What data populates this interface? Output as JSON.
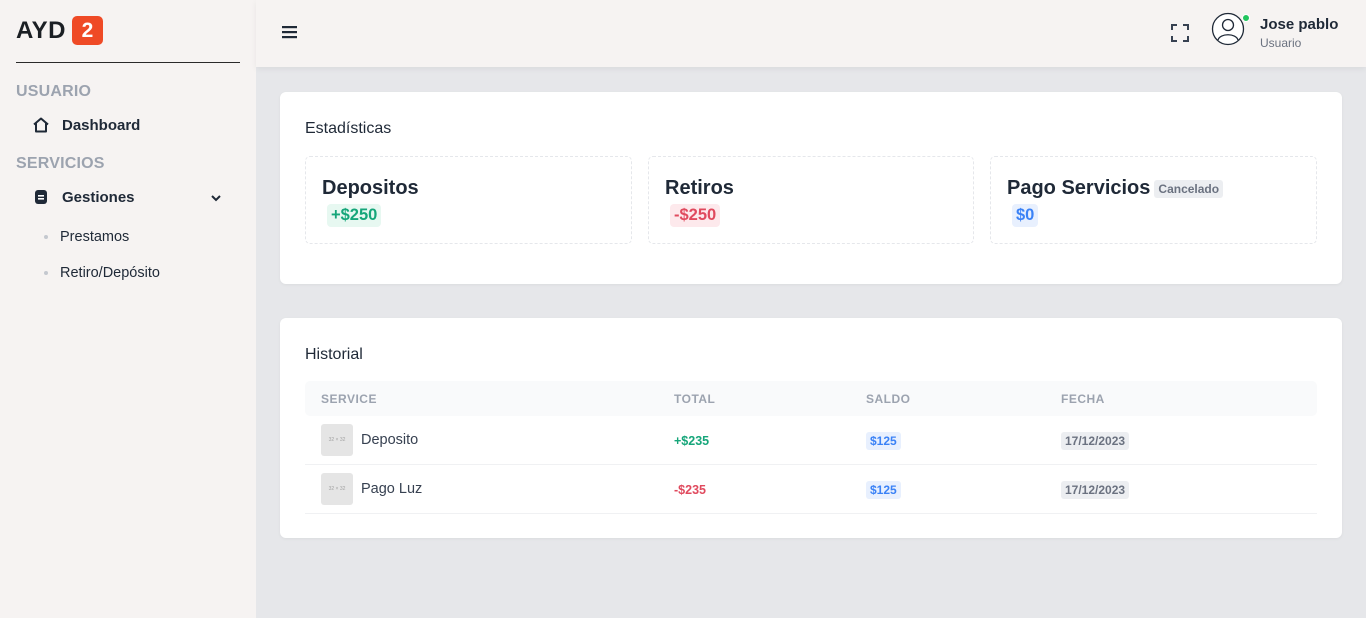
{
  "logo": {
    "text": "AYD",
    "badge": "2"
  },
  "sidebar": {
    "section_usuario": "USUARIO",
    "dashboard": "Dashboard",
    "section_servicios": "SERVICIOS",
    "gestiones": "Gestiones",
    "sub_items": [
      "Prestamos",
      "Retiro/Depósito"
    ]
  },
  "header": {
    "user_name": "Jose pablo",
    "user_role": "Usuario"
  },
  "stats": {
    "title": "Estadísticas",
    "items": [
      {
        "label": "Depositos",
        "amount": "+$250"
      },
      {
        "label": "Retiros",
        "amount": "-$250"
      },
      {
        "label": "Pago Servicios",
        "tag": "Cancelado",
        "amount": "$0"
      }
    ]
  },
  "history": {
    "title": "Historial",
    "columns": [
      "SERVICE",
      "TOTAL",
      "SALDO",
      "FECHA"
    ],
    "thumb_text": "32 × 32",
    "rows": [
      {
        "service": "Deposito",
        "total": "+$235",
        "saldo": "$125",
        "fecha": "17/12/2023"
      },
      {
        "service": "Pago Luz",
        "total": "-$235",
        "saldo": "$125",
        "fecha": "17/12/2023"
      }
    ]
  },
  "colors": {
    "accent": "#ef4a26",
    "green": "#16a67a",
    "red": "#e04a5e",
    "blue": "#3b82f6",
    "online": "#22c55e"
  },
  "icons": [
    "home-icon",
    "folder-icon",
    "chevron-down-icon",
    "hamburger-icon",
    "fullscreen-icon",
    "user-avatar-icon"
  ]
}
